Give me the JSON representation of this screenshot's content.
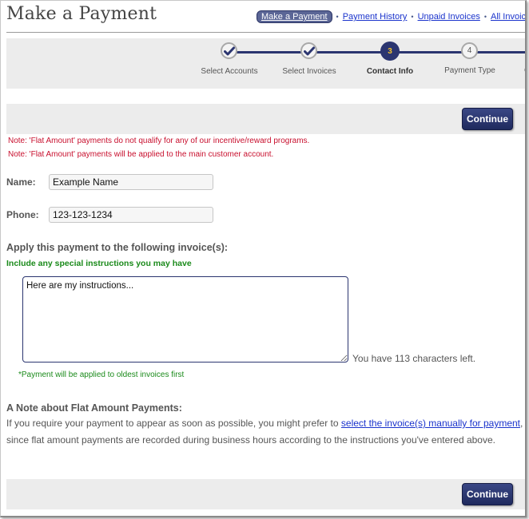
{
  "page": {
    "title": "Make a Payment"
  },
  "topnav": {
    "items": [
      {
        "label": "Make a Payment",
        "active": true
      },
      {
        "label": "Payment History",
        "active": false
      },
      {
        "label": "Unpaid Invoices",
        "active": false
      },
      {
        "label": "All Invoic",
        "active": false
      }
    ],
    "separator": "•"
  },
  "steps": [
    {
      "label": "Select Accounts",
      "state": "done",
      "marker": "check-icon"
    },
    {
      "label": "Select Invoices",
      "state": "done",
      "marker": "check-icon"
    },
    {
      "label": "Contact Info",
      "state": "current",
      "marker": "3"
    },
    {
      "label": "Payment Type",
      "state": "todo",
      "marker": "4"
    },
    {
      "label": "Co",
      "state": "todo",
      "marker": ""
    }
  ],
  "actions": {
    "continue_label": "Continue"
  },
  "notes": [
    "Note: 'Flat Amount' payments do not qualify for any of our incentive/reward programs.",
    "Note: 'Flat Amount' payments will be applied to the main customer account."
  ],
  "form": {
    "name_label": "Name:",
    "name_value": "Example Name",
    "phone_label": "Phone:",
    "phone_value": "123-123-1234",
    "apply_heading": "Apply this payment to the following invoice(s):",
    "instructions_hint": "Include any special instructions you may have",
    "instructions_value": "Here are my instructions...",
    "char_count": "You have 113 characters left.",
    "oldest_note": "*Payment will be applied to oldest invoices first"
  },
  "flat_note": {
    "heading": "A Note about Flat Amount Payments:",
    "text_before": "If you require your payment to appear as soon as possible, you might prefer to ",
    "link": "select the invoice(s) manually for payment",
    "text_after": ", since flat amount payments are recorded during business hours according to the instructions you've entered above."
  },
  "colors": {
    "brand_navy": "#2b3570",
    "note_red": "#c8102e",
    "hint_green": "#1a8a1a",
    "link_blue": "#1a33cc",
    "step_current_number": "#f2c230"
  }
}
